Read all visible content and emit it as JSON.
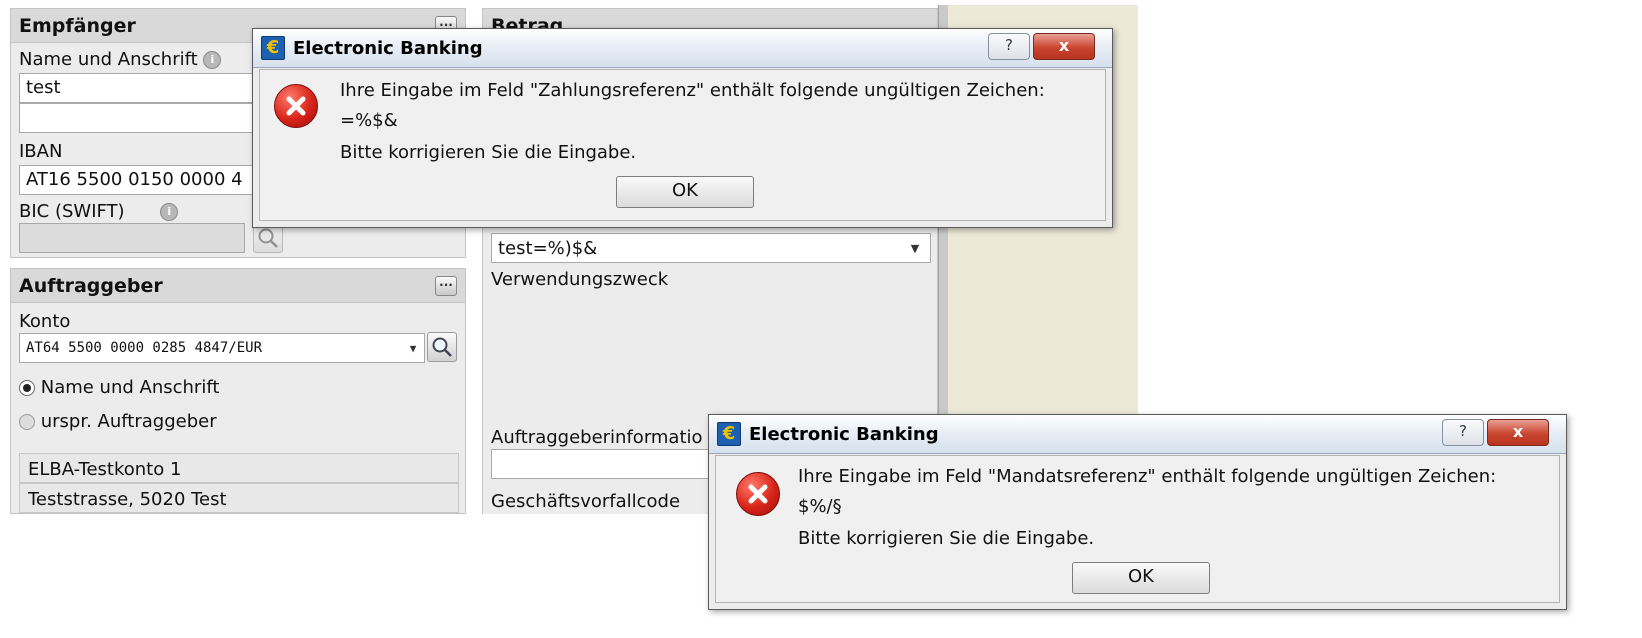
{
  "left_panel": {
    "recipient": {
      "header": "Empfänger",
      "name_label": "Name und Anschrift",
      "name_line1": "test",
      "name_line2": "",
      "iban_label": "IBAN",
      "iban_value": "AT16 5500 0150 0000 4",
      "bic_label": "BIC (SWIFT)",
      "bic_value": ""
    },
    "orderer": {
      "header": "Auftraggeber",
      "account_label": "Konto",
      "account_value": "AT64 5500 0000 0285 4847/EUR",
      "radio_name": "Name und Anschrift",
      "radio_original": "urspr. Auftraggeber",
      "account_name": "ELBA-Testkonto 1",
      "account_address": "Teststrasse, 5020 Test"
    }
  },
  "right_panel": {
    "header": "Betrag",
    "reference_value": "test=%)$&",
    "purpose_label": "Verwendungszweck",
    "orderer_info_label": "Auftraggeberinformatio",
    "orderer_info_value": "",
    "business_code_label": "Geschäftsvorfallcode"
  },
  "dialog1": {
    "title": "Electronic Banking",
    "help": "?",
    "close": "x",
    "message_line1": "Ihre Eingabe im Feld \"Zahlungsreferenz\" enthält folgende ungültigen Zeichen:",
    "message_line2": "=%$&",
    "message_line3": "Bitte korrigieren Sie die Eingabe.",
    "ok": "OK"
  },
  "dialog2": {
    "title": "Electronic Banking",
    "help": "?",
    "close": "x",
    "message_line1": "Ihre Eingabe im Feld \"Mandatsreferenz\" enthält folgende ungültigen Zeichen:",
    "message_line2": "$%/§",
    "message_line3": "Bitte korrigieren Sie die Eingabe.",
    "ok": "OK"
  },
  "icons": {
    "dots": "...",
    "info": "i",
    "euro": "€",
    "dropdown": "▼"
  }
}
